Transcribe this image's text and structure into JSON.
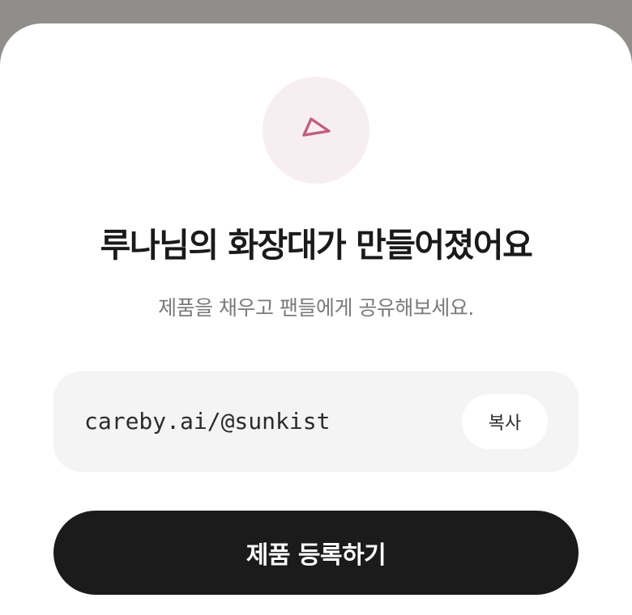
{
  "sheet": {
    "icon": "send-arrow-icon",
    "title": "루나님의 화장대가 만들어졌어요",
    "subtitle": "제품을 채우고 팬들에게 공유해보세요.",
    "link": {
      "url": "careby.ai/@sunkist",
      "copy_label": "복사"
    },
    "primary_button_label": "제품 등록하기"
  },
  "colors": {
    "backdrop": "#908e8b",
    "sheet": "#ffffff",
    "icon_circle": "#f7eef1",
    "icon_stroke": "#c0607e",
    "link_box": "#f4f4f4",
    "primary_button": "#1b1b1c"
  }
}
